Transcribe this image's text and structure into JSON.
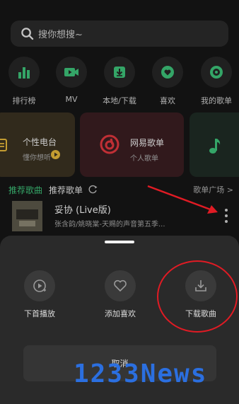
{
  "search": {
    "placeholder": "搜你想搜~"
  },
  "shortcuts": [
    {
      "label": "排行榜",
      "icon": "chart-bars-icon"
    },
    {
      "label": "MV",
      "icon": "video-camera-icon"
    },
    {
      "label": "本地/下载",
      "icon": "download-box-icon"
    },
    {
      "label": "喜欢",
      "icon": "heart-icon"
    },
    {
      "label": "我的歌单",
      "icon": "vinyl-record-icon"
    }
  ],
  "cards": [
    {
      "title": "个性电台",
      "subtitle": "懂你想听"
    },
    {
      "title": "网易歌单",
      "subtitle": "个人歌单"
    }
  ],
  "recommend": {
    "tab1": "推荐歌曲",
    "tab2": "推荐歌单",
    "more": "歌单广场 >"
  },
  "song": {
    "title": "妥协 (Live版)",
    "artist": "张含韵/姚晓棠-天赐的声音第五季..."
  },
  "sheet": {
    "actions": [
      {
        "label": "下首播放",
        "icon": "play-next-icon"
      },
      {
        "label": "添加喜欢",
        "icon": "heart-outline-icon"
      },
      {
        "label": "下载歌曲",
        "icon": "download-icon"
      }
    ],
    "cancel": "取消"
  },
  "watermark": "1233News",
  "colors": {
    "accent_green": "#3ec27a",
    "annotation_red": "#e01b24",
    "watermark_blue": "#2b6fe0"
  }
}
